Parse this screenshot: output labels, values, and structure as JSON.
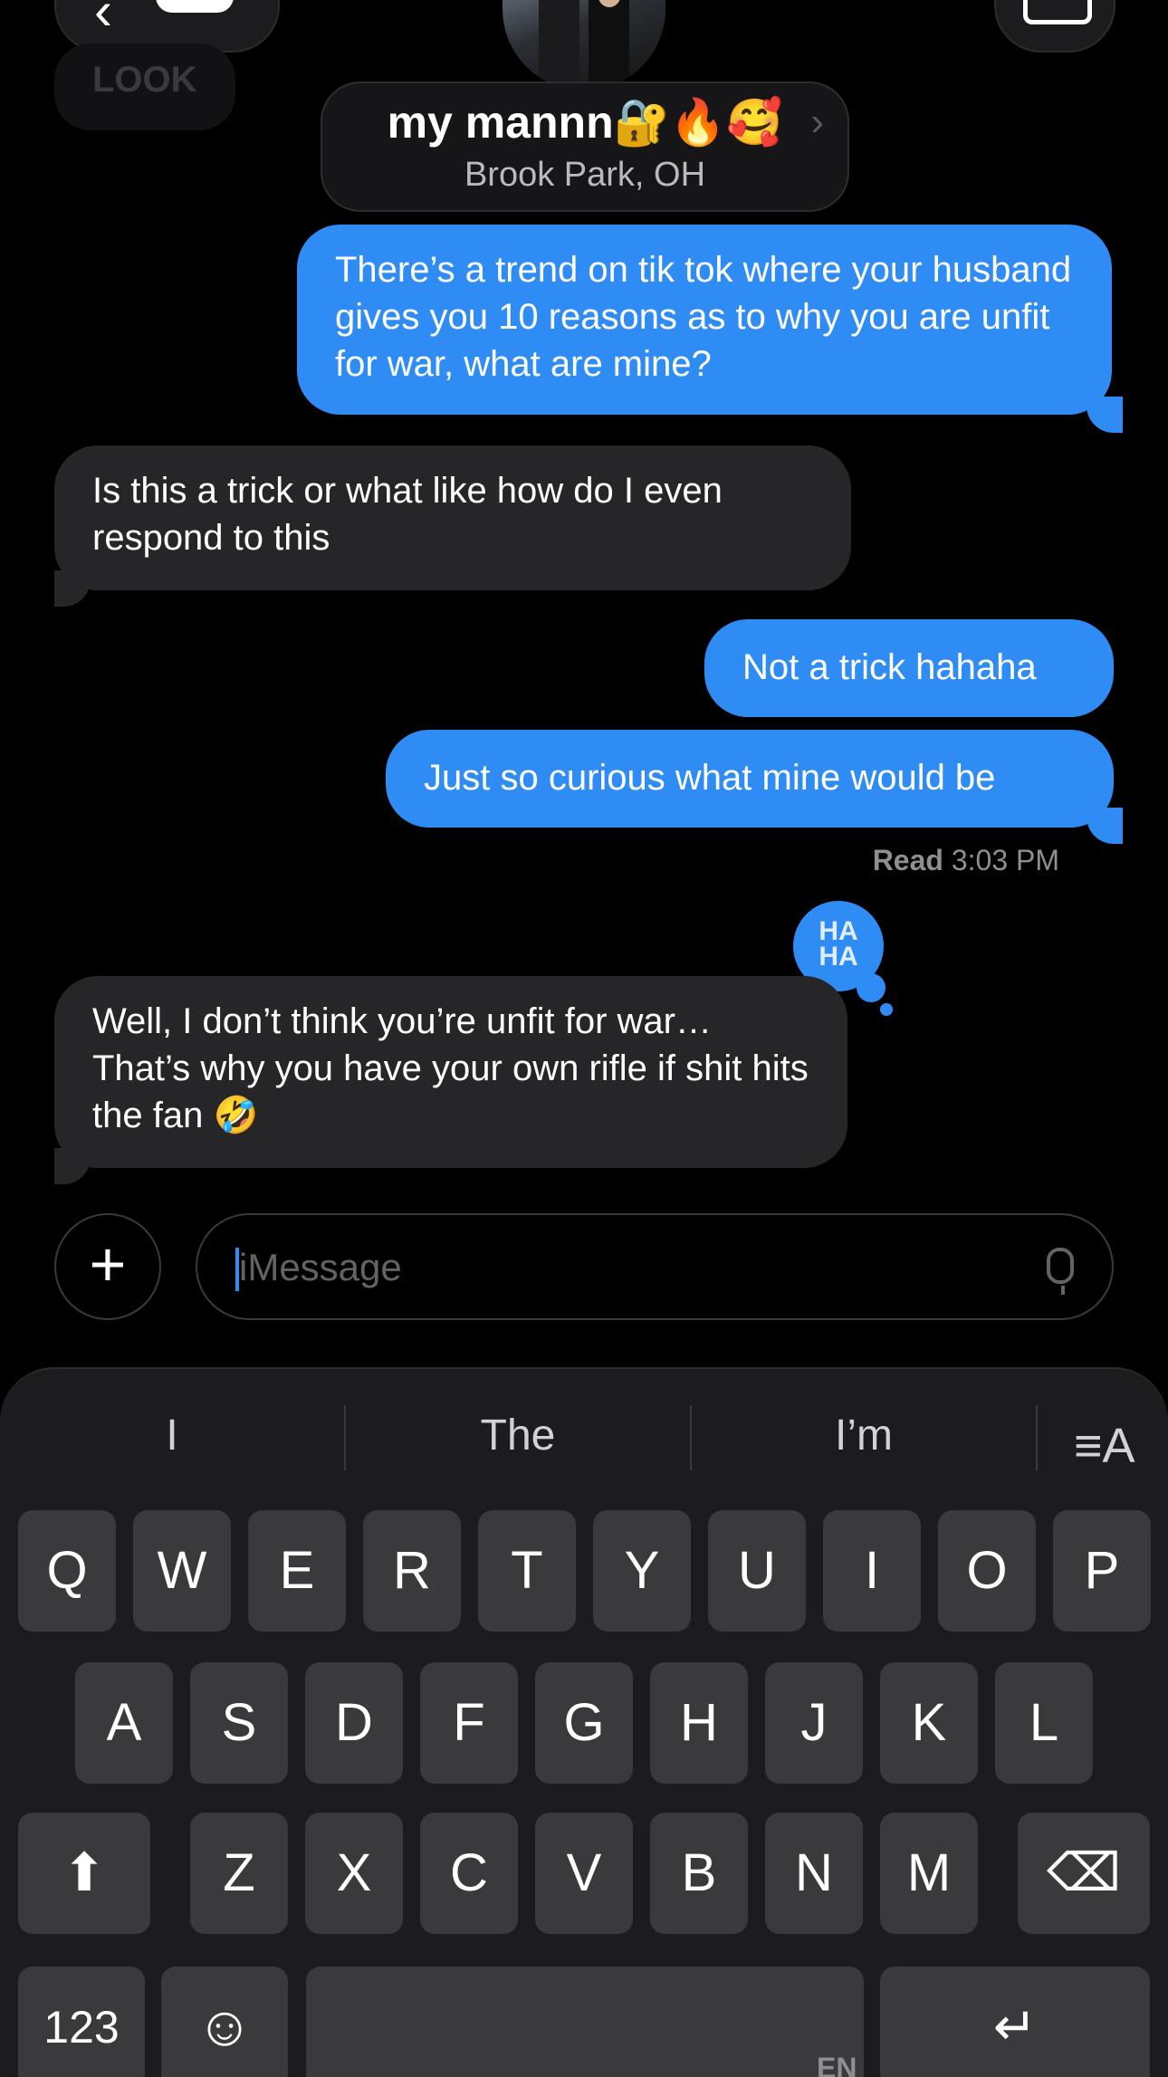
{
  "header": {
    "contact_name": "my mannn🔐🔥🥰",
    "contact_location": "Brook Park, OH",
    "chevron": "›",
    "ghost_label": "LOOK"
  },
  "messages": [
    {
      "from": "me",
      "text": "There’s a trend on tik tok where your husband gives you 10 reasons as to why you are unfit for war, what are mine?"
    },
    {
      "from": "them",
      "text": "Is this a trick or what like how do I even respond to this"
    },
    {
      "from": "me",
      "text": "Not a trick hahaha"
    },
    {
      "from": "me",
      "text": "Just so curious what mine would be"
    },
    {
      "from": "them",
      "text": "Well, I don’t think you’re unfit for war… That’s why you have your own rifle if shit hits the fan 🤣"
    }
  ],
  "read_receipt": {
    "label": "Read",
    "time": "3:03 PM"
  },
  "reaction": {
    "line1": "HA",
    "line2": "HA"
  },
  "input": {
    "plus": "+",
    "placeholder": "iMessage"
  },
  "keyboard": {
    "suggestions": [
      "I",
      "The",
      "I’m"
    ],
    "format_icon": "≡A",
    "row1": [
      "Q",
      "W",
      "E",
      "R",
      "T",
      "Y",
      "U",
      "I",
      "O",
      "P"
    ],
    "row2": [
      "A",
      "S",
      "D",
      "F",
      "G",
      "H",
      "J",
      "K",
      "L"
    ],
    "row3": [
      "Z",
      "X",
      "C",
      "V",
      "B",
      "N",
      "M"
    ],
    "shift": "⬆",
    "delete": "⌫",
    "numbers": "123",
    "emoji": "☺",
    "return": "↵",
    "language": "EN"
  }
}
